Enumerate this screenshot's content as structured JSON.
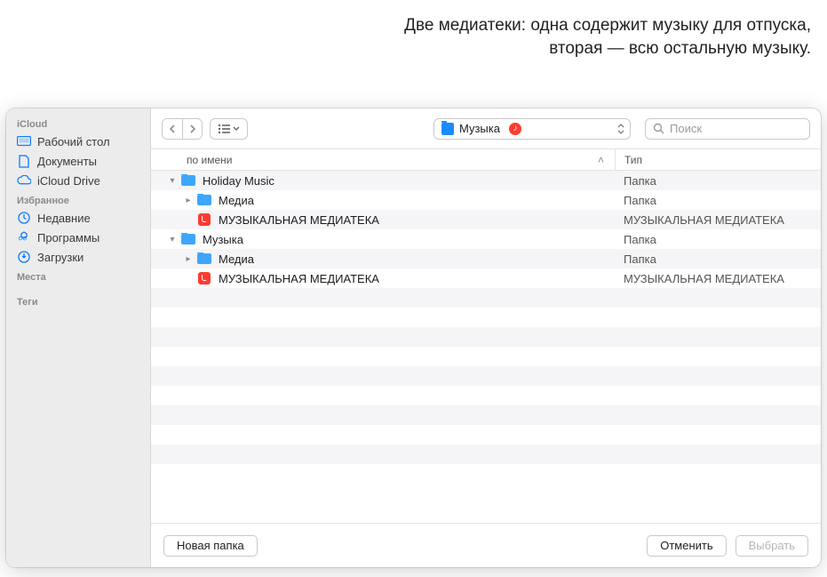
{
  "annotation": "Две медиатеки: одна содержит музыку для отпуска, вторая — всю остальную музыку.",
  "sidebar": {
    "sections": [
      {
        "title": "iCloud",
        "items": [
          {
            "label": "Рабочий стол",
            "icon": "desktop"
          },
          {
            "label": "Документы",
            "icon": "doc"
          },
          {
            "label": "iCloud Drive",
            "icon": "cloud"
          }
        ]
      },
      {
        "title": "Избранное",
        "items": [
          {
            "label": "Недавние",
            "icon": "clock"
          },
          {
            "label": "Программы",
            "icon": "app"
          },
          {
            "label": "Загрузки",
            "icon": "download"
          }
        ]
      },
      {
        "title": "Места",
        "items": []
      },
      {
        "title": "Теги",
        "items": []
      }
    ]
  },
  "toolbar": {
    "path_label": "Музыка",
    "search_placeholder": "Поиск"
  },
  "columns": {
    "name": "по имени",
    "type": "Тип"
  },
  "rows": [
    {
      "indent": 0,
      "disclosure": "down",
      "icon": "folder",
      "name": "Holiday Music",
      "type": "Папка",
      "stripe": true
    },
    {
      "indent": 1,
      "disclosure": "right",
      "icon": "folder",
      "name": "Медиа",
      "type": "Папка",
      "stripe": false
    },
    {
      "indent": 1,
      "disclosure": "",
      "icon": "lib",
      "name": "МУЗЫКАЛЬНАЯ МЕДИАТЕКА",
      "type": "МУЗЫКАЛЬНАЯ МЕДИАТЕКА",
      "stripe": true
    },
    {
      "indent": 0,
      "disclosure": "down",
      "icon": "folder",
      "name": "Музыка",
      "type": "Папка",
      "stripe": false
    },
    {
      "indent": 1,
      "disclosure": "right",
      "icon": "folder",
      "name": "Медиа",
      "type": "Папка",
      "stripe": true
    },
    {
      "indent": 1,
      "disclosure": "",
      "icon": "lib",
      "name": "МУЗЫКАЛЬНАЯ МЕДИАТЕКА",
      "type": "МУЗЫКАЛЬНАЯ МЕДИАТЕКА",
      "stripe": false
    }
  ],
  "empty_rows": [
    true,
    false,
    true,
    false,
    true,
    false,
    true,
    false,
    true,
    false
  ],
  "bottombar": {
    "new_folder": "Новая папка",
    "cancel": "Отменить",
    "choose": "Выбрать"
  }
}
